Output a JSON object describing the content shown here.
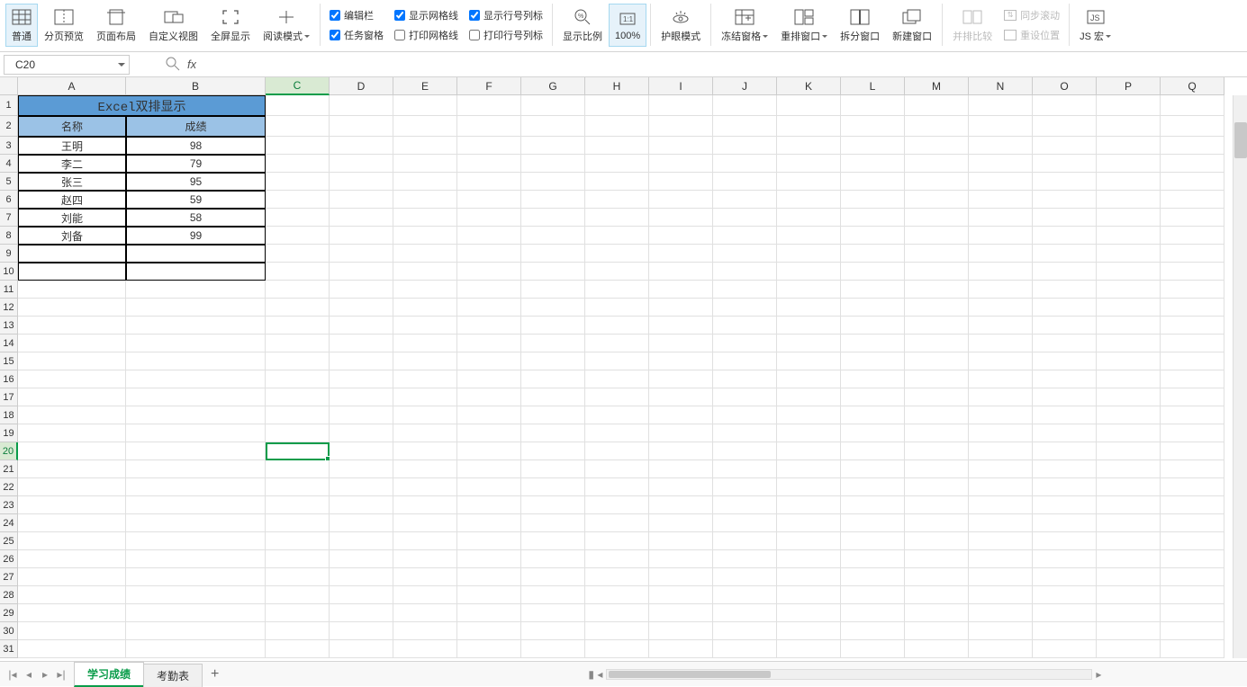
{
  "ribbon": {
    "normal": "普通",
    "pagebreak": "分页预览",
    "pagelayout": "页面布局",
    "customview": "自定义视图",
    "fullscreen": "全屏显示",
    "readmode": "阅读模式",
    "chk_editbar": "编辑栏",
    "chk_taskpane": "任务窗格",
    "chk_gridlines": "显示网格线",
    "chk_printgrid": "打印网格线",
    "chk_rowcolhead": "显示行号列标",
    "chk_printhead": "打印行号列标",
    "zoom": "显示比例",
    "zoom100": "100%",
    "eyecare": "护眼模式",
    "freeze": "冻结窗格",
    "arrange": "重排窗口",
    "split": "拆分窗口",
    "newwin": "新建窗口",
    "sidebyside": "并排比较",
    "syncscroll": "同步滚动",
    "resetpos": "重设位置",
    "jsmacro": "JS 宏"
  },
  "namebox": "C20",
  "fx": "fx",
  "columns": [
    "A",
    "B",
    "C",
    "D",
    "E",
    "F",
    "G",
    "H",
    "I",
    "J",
    "K",
    "L",
    "M",
    "N",
    "O",
    "P",
    "Q"
  ],
  "sheet": {
    "title": "Excel双排显示",
    "headers": [
      "名称",
      "成绩"
    ],
    "rows": [
      {
        "name": "王明",
        "score": "98"
      },
      {
        "name": "李二",
        "score": "79"
      },
      {
        "name": "张三",
        "score": "95"
      },
      {
        "name": "赵四",
        "score": "59"
      },
      {
        "name": "刘能",
        "score": "58"
      },
      {
        "name": "刘备",
        "score": "99"
      }
    ]
  },
  "tabs": {
    "active": "学习成绩",
    "other": "考勤表"
  },
  "selected_cell": "C20"
}
